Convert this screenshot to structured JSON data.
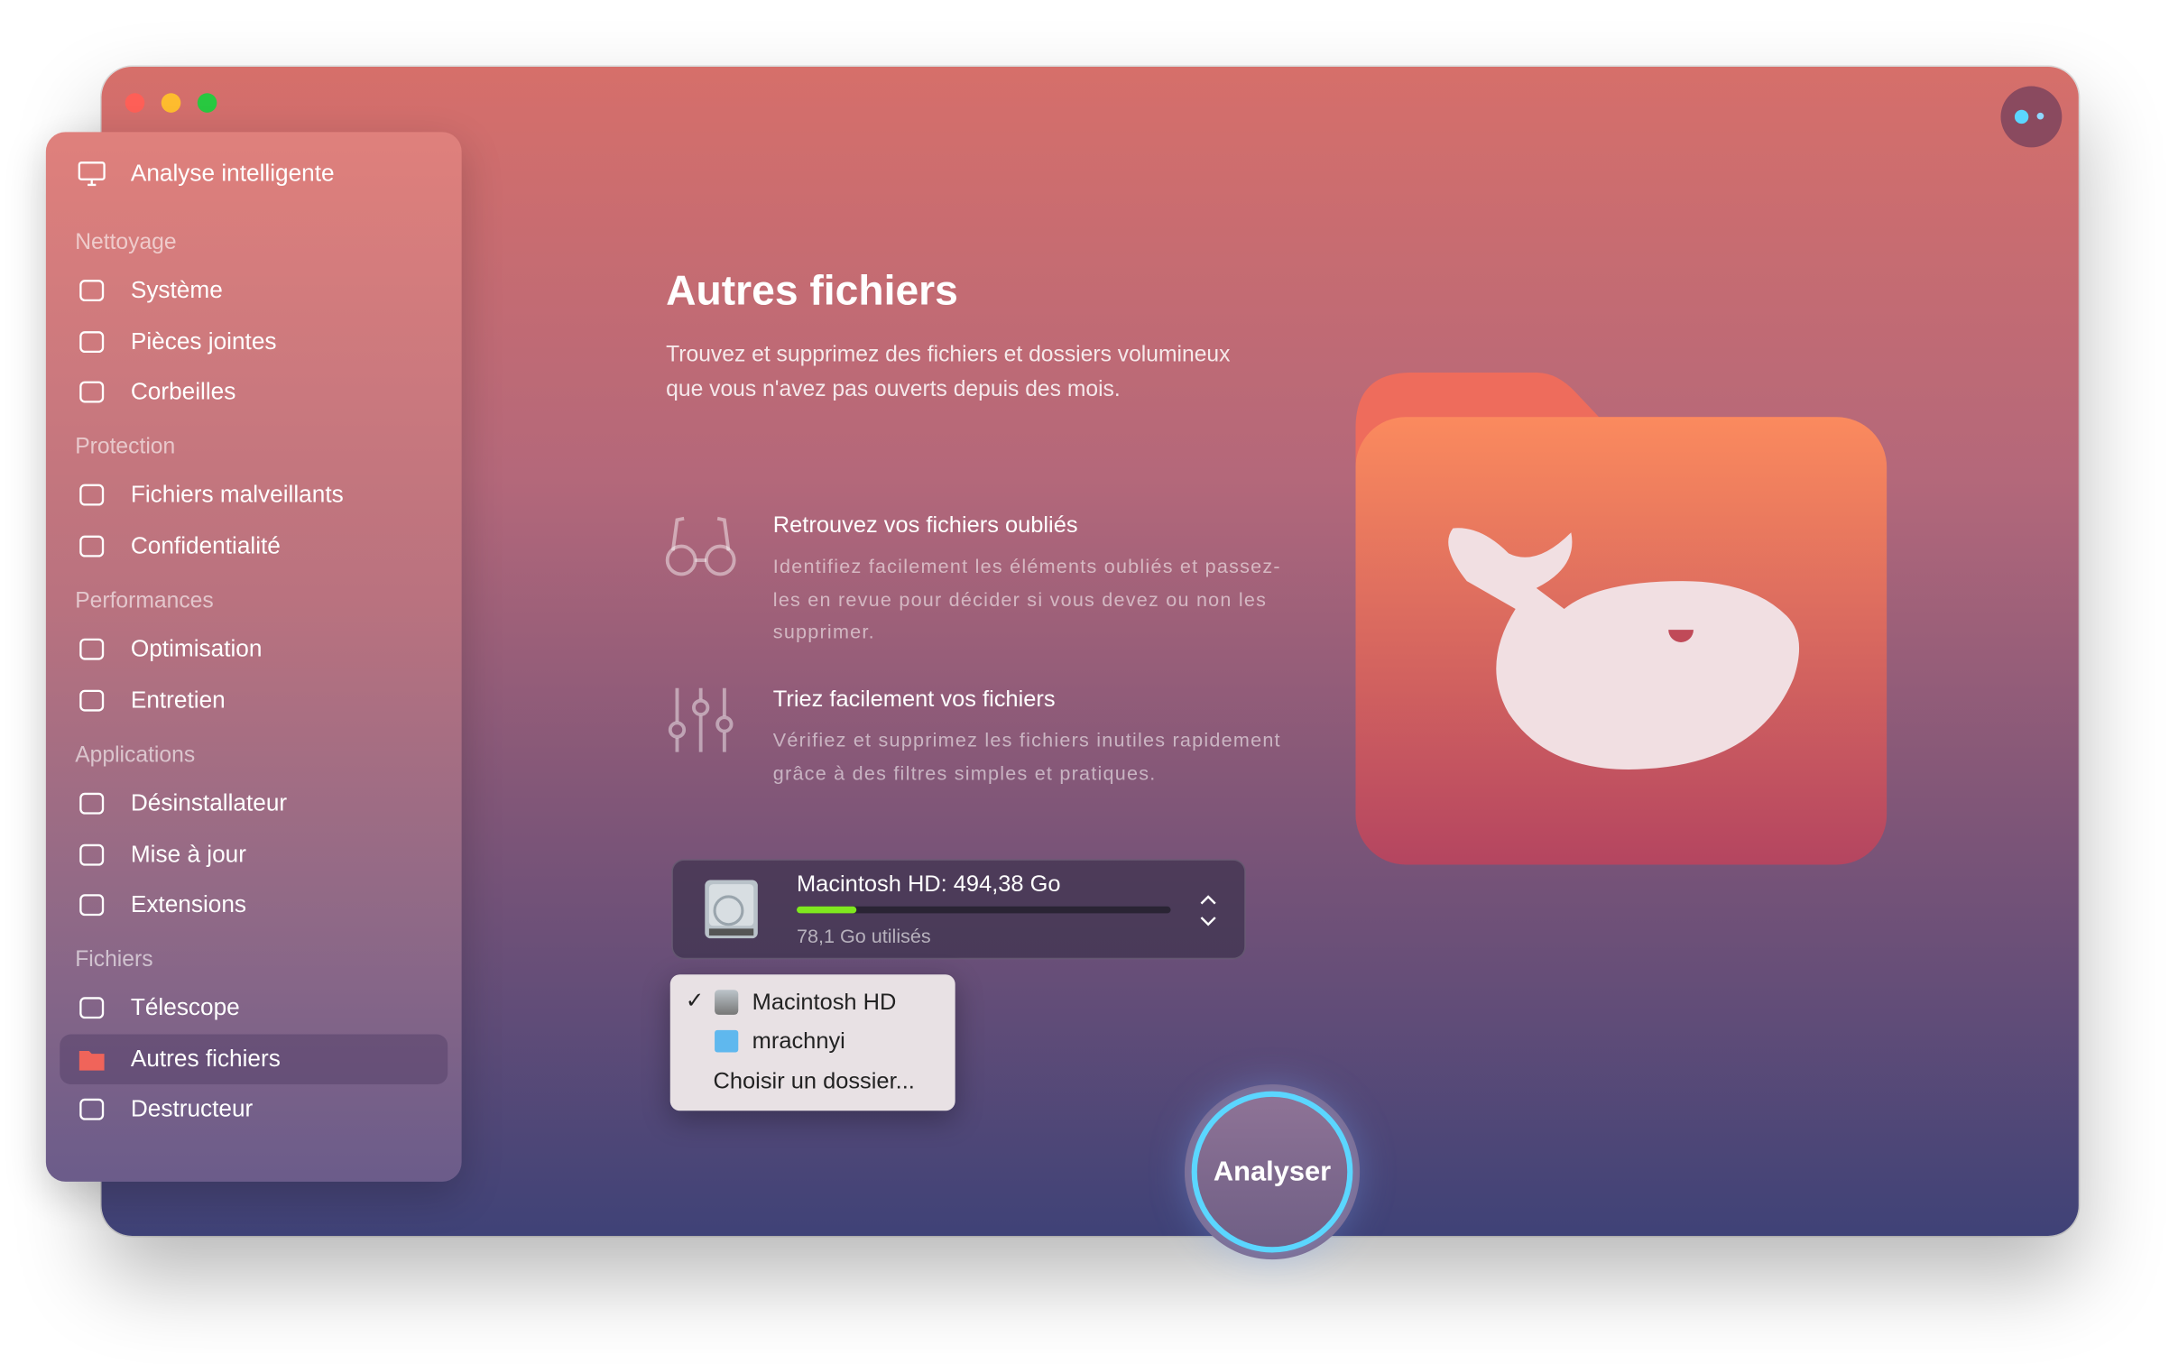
{
  "window": {
    "traffic_lights": {
      "close": "#fe5f57",
      "minimize": "#febc2e",
      "zoom": "#28c840"
    }
  },
  "sidebar": {
    "top": {
      "label": "Analyse intelligente",
      "icon": "monitor-icon"
    },
    "sections": [
      {
        "title": "Nettoyage",
        "items": [
          {
            "label": "Système",
            "icon": "system-icon"
          },
          {
            "label": "Pièces jointes",
            "icon": "mail-icon"
          },
          {
            "label": "Corbeilles",
            "icon": "trash-icon"
          }
        ]
      },
      {
        "title": "Protection",
        "items": [
          {
            "label": "Fichiers malveillants",
            "icon": "biohazard-icon"
          },
          {
            "label": "Confidentialité",
            "icon": "hand-icon"
          }
        ]
      },
      {
        "title": "Performances",
        "items": [
          {
            "label": "Optimisation",
            "icon": "sliders-icon"
          },
          {
            "label": "Entretien",
            "icon": "wrench-icon"
          }
        ]
      },
      {
        "title": "Applications",
        "items": [
          {
            "label": "Désinstallateur",
            "icon": "uninstaller-icon"
          },
          {
            "label": "Mise à jour",
            "icon": "update-icon"
          },
          {
            "label": "Extensions",
            "icon": "extensions-icon"
          }
        ]
      },
      {
        "title": "Fichiers",
        "items": [
          {
            "label": "Télescope",
            "icon": "lens-icon"
          },
          {
            "label": "Autres fichiers",
            "icon": "folder-icon",
            "active": true
          },
          {
            "label": "Destructeur",
            "icon": "shredder-icon"
          }
        ]
      }
    ]
  },
  "main": {
    "title": "Autres fichiers",
    "description": "Trouvez et supprimez des fichiers et dossiers volumineux que vous n'avez pas ouverts depuis des mois.",
    "features": [
      {
        "title": "Retrouvez vos fichiers oubliés",
        "text": "Identifiez facilement les éléments oubliés et passez-les en revue pour décider si vous devez ou non les supprimer.",
        "icon": "glasses-icon"
      },
      {
        "title": "Triez facilement vos fichiers",
        "text": "Vérifiez et supprimez les fichiers inutiles rapidement grâce à des filtres simples et pratiques.",
        "icon": "sliders-icon"
      }
    ],
    "disk": {
      "name": "Macintosh HD: 494,38 Go",
      "used": "78,1 Go utilisés",
      "used_fraction": 0.158,
      "bar_color": "#7fe81f"
    },
    "menu": {
      "items": [
        {
          "label": "Macintosh HD",
          "checked": true
        },
        {
          "label": "mrachnyi"
        },
        {
          "label": "Choisir un dossier..."
        }
      ]
    },
    "analyse_button": "Analyser",
    "accent": "#5bd6ff"
  }
}
